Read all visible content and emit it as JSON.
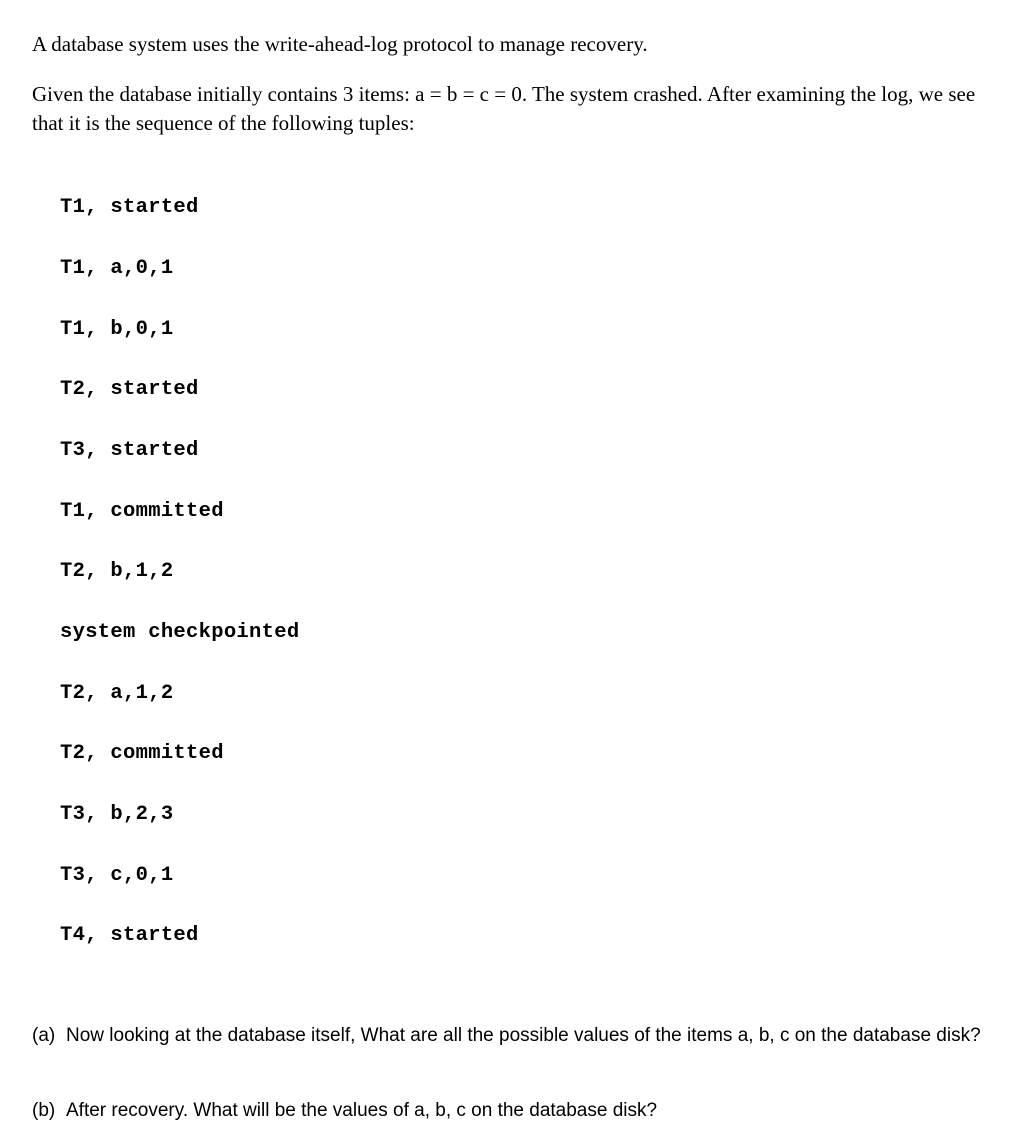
{
  "intro": {
    "para1": "A database system uses the write-ahead-log protocol to manage recovery.",
    "para2": "Given the database initially contains 3 items: a = b = c = 0. The system crashed. After examining the log, we see that it is the sequence of the following tuples:"
  },
  "log_entries": [
    "T1, started",
    "T1, a,0,1",
    "T1, b,0,1",
    "T2, started",
    "T3, started",
    "T1, committed",
    "T2, b,1,2",
    "system checkpointed",
    "T2, a,1,2",
    "T2, committed",
    "T3, b,2,3",
    "T3, c,0,1",
    "T4, started"
  ],
  "questions": {
    "a": {
      "label": "(a)",
      "text": "Now looking at the database itself, What are all the possible values of the items a, b, c on the database disk?"
    },
    "b": {
      "label": "(b)",
      "text": "After recovery. What will be the values of a, b, c on the database disk?"
    }
  }
}
